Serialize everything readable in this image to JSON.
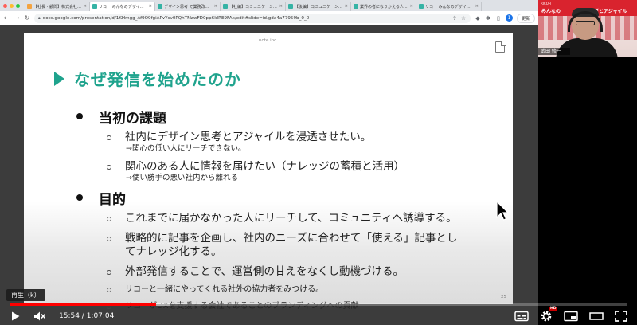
{
  "browser": {
    "tabs": [
      {
        "title": "【社長・顧問】株式会社リ...",
        "color": "#f4a340"
      },
      {
        "title": "リコー みんなのデザインと...",
        "color": "#35b3a5"
      },
      {
        "title": "デザイン思考 で業務改...",
        "color": "#35b3a5"
      },
      {
        "title": "【社編】コミュニケーショ...",
        "color": "#35b3a5"
      },
      {
        "title": "【後編】コミュニケーショ...",
        "color": "#35b3a5"
      },
      {
        "title": "業界の者になりかえる人...",
        "color": "#35b3a5"
      },
      {
        "title": "リコー みんなのデザインと...",
        "color": "#35b3a5"
      }
    ],
    "url": "docs.google.com/presentation/d/1KHmgg_Af9O9fgiAPvYsv0PQhTMzwFD0pp6kIRE9FAk/edit#slide=id.gda4a77959b_0_0",
    "avatar_letter": "1",
    "update_label": "更新"
  },
  "slide": {
    "company": "note inc.",
    "title": "なぜ発信を始めたのか",
    "page_number": "25",
    "sections": [
      {
        "heading": "当初の課題",
        "items": [
          {
            "text": "社内にデザイン思考とアジャイルを浸透させたい。",
            "note": "→関心の低い人にリーチできない。"
          },
          {
            "text": "関心のある人に情報を届けたい（ナレッジの蓄積と活用）",
            "note": "→使い勝手の悪い社内から離れる"
          }
        ]
      },
      {
        "heading": "目的",
        "items": [
          {
            "text": "これまでに届かなかった人にリーチして、コミュニティへ誘導する。"
          },
          {
            "text": "戦略的に記事を企画し、社内のニーズに合わせて「使える」記事とし",
            "text2": "てナレッジ化する。"
          },
          {
            "text": "外部発信することで、運営側の甘えをなくし動機づける。"
          },
          {
            "text": "リコーと一緒にやってくれる社外の協力者をみつける。"
          },
          {
            "text": "リコーがDXを支援する会社であることのブランディングへの貢献"
          }
        ]
      }
    ]
  },
  "webcam": {
    "banner_small": "RICOH",
    "banner_text": "みんなの",
    "banner_text2": "思考とアジャイル",
    "name": "武田 修一"
  },
  "player": {
    "tooltip": "再生（k）",
    "time_current": "15:54",
    "time_total": "1:07:04",
    "time_display": "15:54 / 1:07:04",
    "progress_played": 0.237,
    "progress_loaded": 0.26,
    "hd_badge": "HD"
  },
  "colors": {
    "accent": "#1fa38d",
    "progress": "#ff0000"
  }
}
